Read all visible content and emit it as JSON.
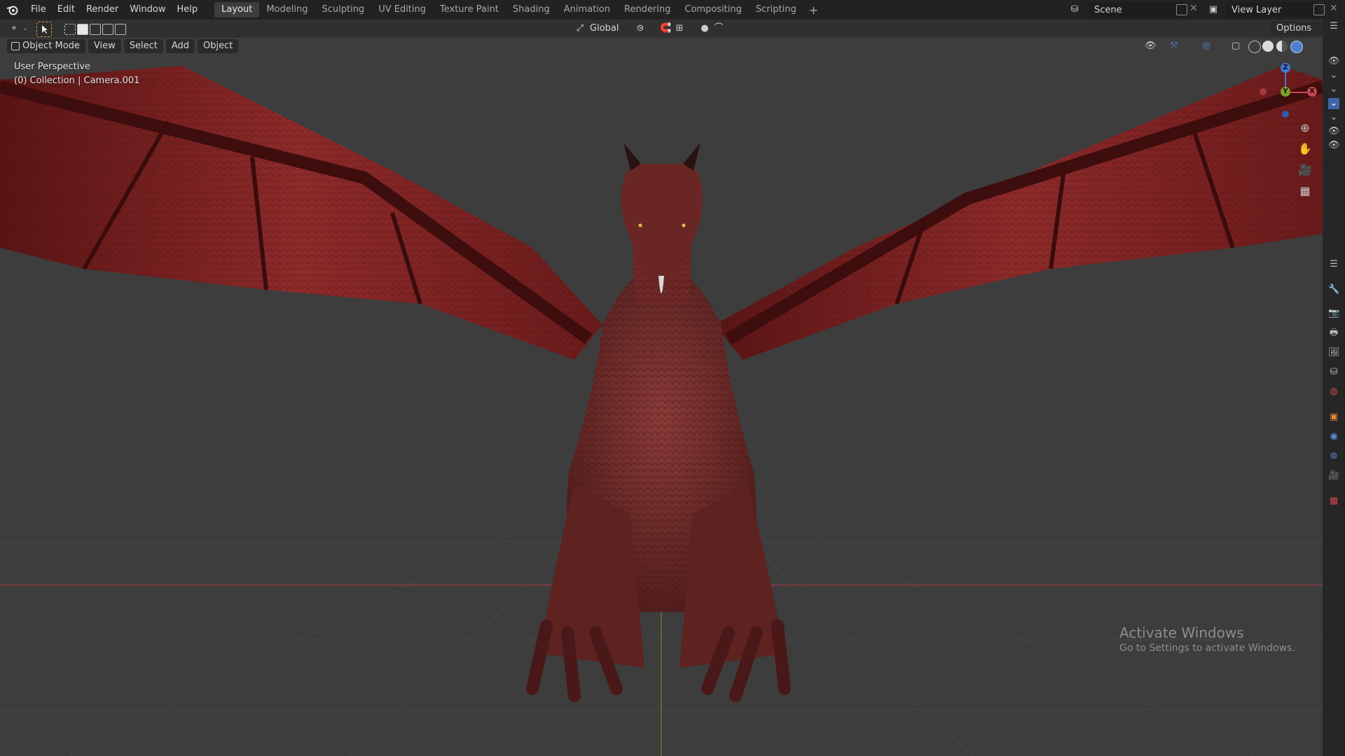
{
  "menubar": {
    "items": [
      "File",
      "Edit",
      "Render",
      "Window",
      "Help"
    ],
    "workspaces": [
      "Layout",
      "Modeling",
      "Sculpting",
      "UV Editing",
      "Texture Paint",
      "Shading",
      "Animation",
      "Rendering",
      "Compositing",
      "Scripting"
    ],
    "active_workspace": "Layout",
    "add_tab": "+",
    "scene": "Scene",
    "view_layer": "View Layer"
  },
  "tool_settings": {
    "transform_orientation": "Global",
    "options_label": "Options"
  },
  "viewport_header": {
    "mode": "Object Mode",
    "menus": [
      "View",
      "Select",
      "Add",
      "Object"
    ]
  },
  "viewport": {
    "perspective_label": "User Perspective",
    "collection_label": "(0) Collection | Camera.001",
    "gizmo": {
      "z": "Z",
      "y": "Y",
      "x": "X"
    }
  },
  "watermark": {
    "title": "Activate Windows",
    "subtitle": "Go to Settings to activate Windows."
  },
  "colors": {
    "axis_x": "#c9454f",
    "axis_y": "#7aa02a",
    "axis_z": "#3f79d5",
    "dragon_red": "#7a2a2a"
  }
}
